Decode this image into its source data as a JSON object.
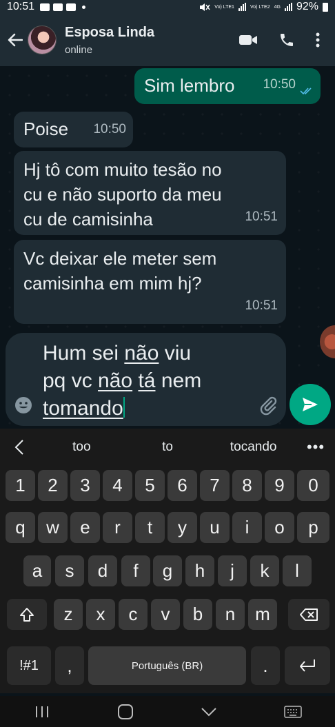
{
  "status_bar": {
    "time": "10:51",
    "sim1": "Vo) LTE1",
    "sim2": "Vo) LTE2",
    "network": "4G",
    "battery": "92%"
  },
  "header": {
    "contact_name": "Esposa Linda",
    "contact_status": "online"
  },
  "messages": [
    {
      "direction": "out",
      "text": "Sim lembro",
      "time": "10:50",
      "status": "read"
    },
    {
      "direction": "in",
      "text": "Poise",
      "time": "10:50"
    },
    {
      "direction": "in",
      "lines": [
        "Hj tô com muito tesão no",
        "cu e não suporto da meu",
        "cu de camisinha"
      ],
      "time": "10:51"
    },
    {
      "direction": "in",
      "lines": [
        "Vc deixar ele meter sem",
        "camisinha em mim hj?"
      ],
      "time": "10:51"
    }
  ],
  "composer": {
    "draft": "Hum sei não viu pq vc não tá nem tomando",
    "draft_parts": [
      "Hum sei ",
      "não",
      " viu",
      "pq vc ",
      "não",
      " ",
      "tá",
      " nem",
      "tomando"
    ]
  },
  "suggestions": [
    "too",
    "to",
    "tocando"
  ],
  "keyboard": {
    "number_row": [
      "1",
      "2",
      "3",
      "4",
      "5",
      "6",
      "7",
      "8",
      "9",
      "0"
    ],
    "row1": [
      "q",
      "w",
      "e",
      "r",
      "t",
      "y",
      "u",
      "i",
      "o",
      "p"
    ],
    "row2": [
      "a",
      "s",
      "d",
      "f",
      "g",
      "h",
      "j",
      "k",
      "l"
    ],
    "row3": [
      "z",
      "x",
      "c",
      "v",
      "b",
      "n",
      "m"
    ],
    "symbols_key": "!#1",
    "comma_key": ",",
    "space_label": "Português (BR)",
    "period_key": "."
  },
  "colors": {
    "header_bg": "#1f2c34",
    "chat_bg": "#0b141a",
    "incoming_bubble": "#1f2c34",
    "outgoing_bubble": "#005c4b",
    "accent": "#00a884",
    "read_ticks": "#53bdeb"
  }
}
